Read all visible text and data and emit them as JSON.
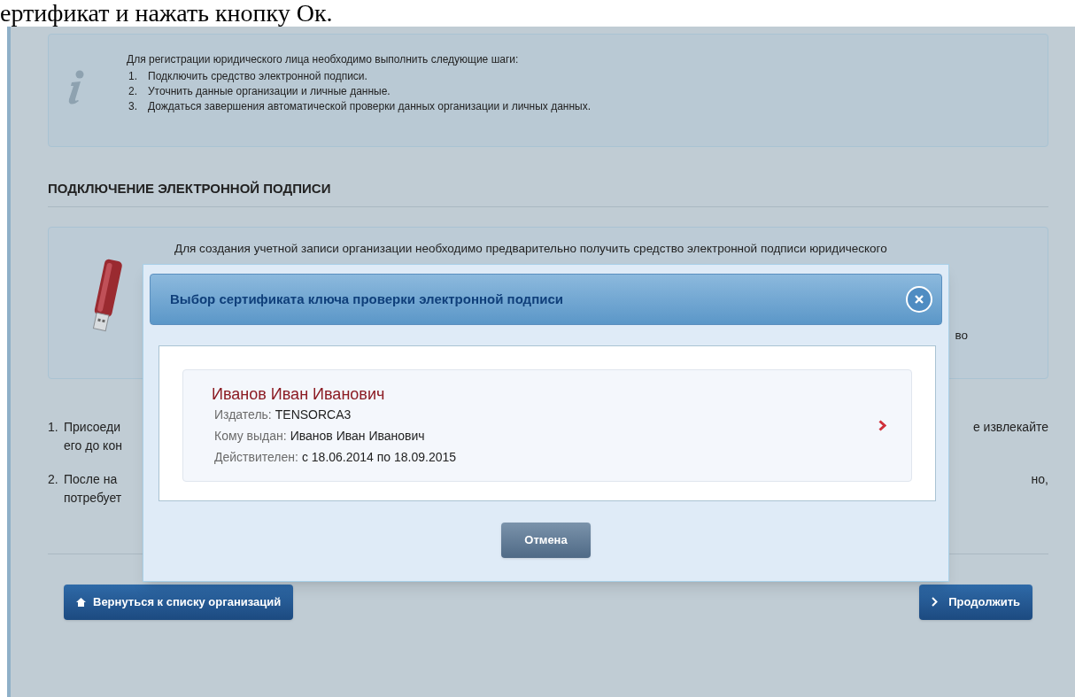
{
  "document_text": "ертификат и нажать кнопку Ок.",
  "info_box": {
    "intro": "Для регистрации юридического лица необходимо выполнить следующие шаги:",
    "steps": [
      {
        "number": "1.",
        "text": "Подключить средство электронной подписи."
      },
      {
        "number": "2.",
        "text": "Уточнить данные организации и личные данные."
      },
      {
        "number": "3.",
        "text": "Дождаться завершения автоматической проверки данных организации и личных данных."
      }
    ]
  },
  "section_title": "ПОДКЛЮЧЕНИЕ ЭЛЕКТРОННОЙ ПОДПИСИ",
  "token_card": {
    "text": "Для создания учетной записи организации необходимо предварительно получить средство электронной подписи юридического",
    "text_end": "во"
  },
  "instructions": [
    {
      "number": "1.",
      "left_lines": [
        "Присоеди",
        "его до кон"
      ],
      "right_lines": [
        "е извлекайте"
      ]
    },
    {
      "number": "2.",
      "left_lines": [
        "После на",
        "потребует"
      ],
      "right_lines": [
        "но,"
      ]
    }
  ],
  "buttons": {
    "back": "Вернуться к списку организаций",
    "continue": "Продолжить"
  },
  "modal": {
    "title": "Выбор сертификата ключа проверки электронной подписи",
    "certificates": [
      {
        "name": "Иванов Иван Иванович",
        "fields": [
          {
            "label": "Издатель:",
            "value": "TENSORCA3"
          },
          {
            "label": "Кому выдан:",
            "value": "Иванов Иван Иванович"
          },
          {
            "label": "Действителен:",
            "value": "с 18.06.2014 по 18.09.2015"
          }
        ]
      }
    ],
    "cancel": "Отмена"
  }
}
